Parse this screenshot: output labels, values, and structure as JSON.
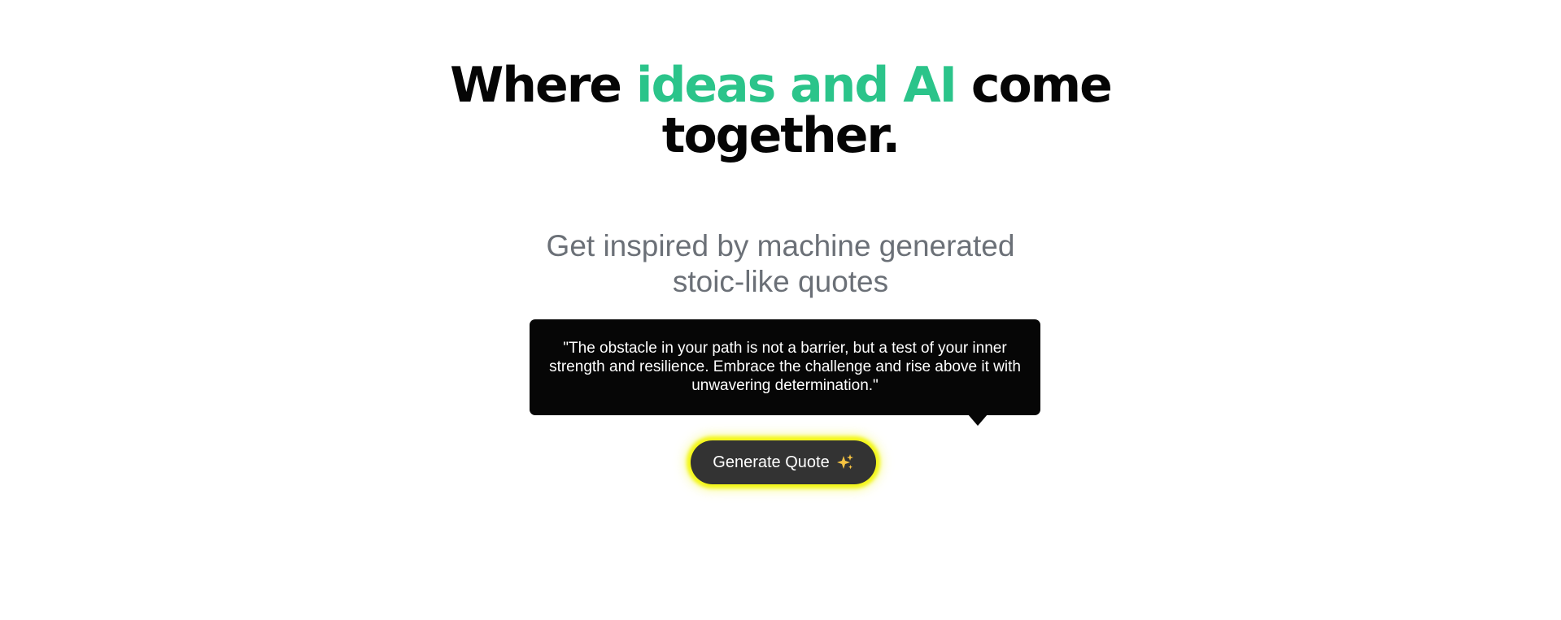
{
  "hero": {
    "title_prefix": "Where",
    "title_accent": "ideas and AI",
    "title_suffix": "come",
    "title_line2": "together.",
    "subtitle_line1": "Get inspired by machine generated",
    "subtitle_line2": "stoic-like quotes"
  },
  "quote": {
    "text": "\"The obstacle in your path is not a barrier, but a test of your inner strength and resilience. Embrace the challenge and rise above it with unwavering determination.\""
  },
  "actions": {
    "generate_label": "Generate Quote",
    "generate_icon": "sparkles-icon"
  },
  "colors": {
    "accent": "#2bc48a",
    "title": "#050505",
    "subtitle": "#6b7077",
    "quote_bg": "#060606",
    "button_bg": "#333333",
    "button_glow": "#f4f71a"
  }
}
